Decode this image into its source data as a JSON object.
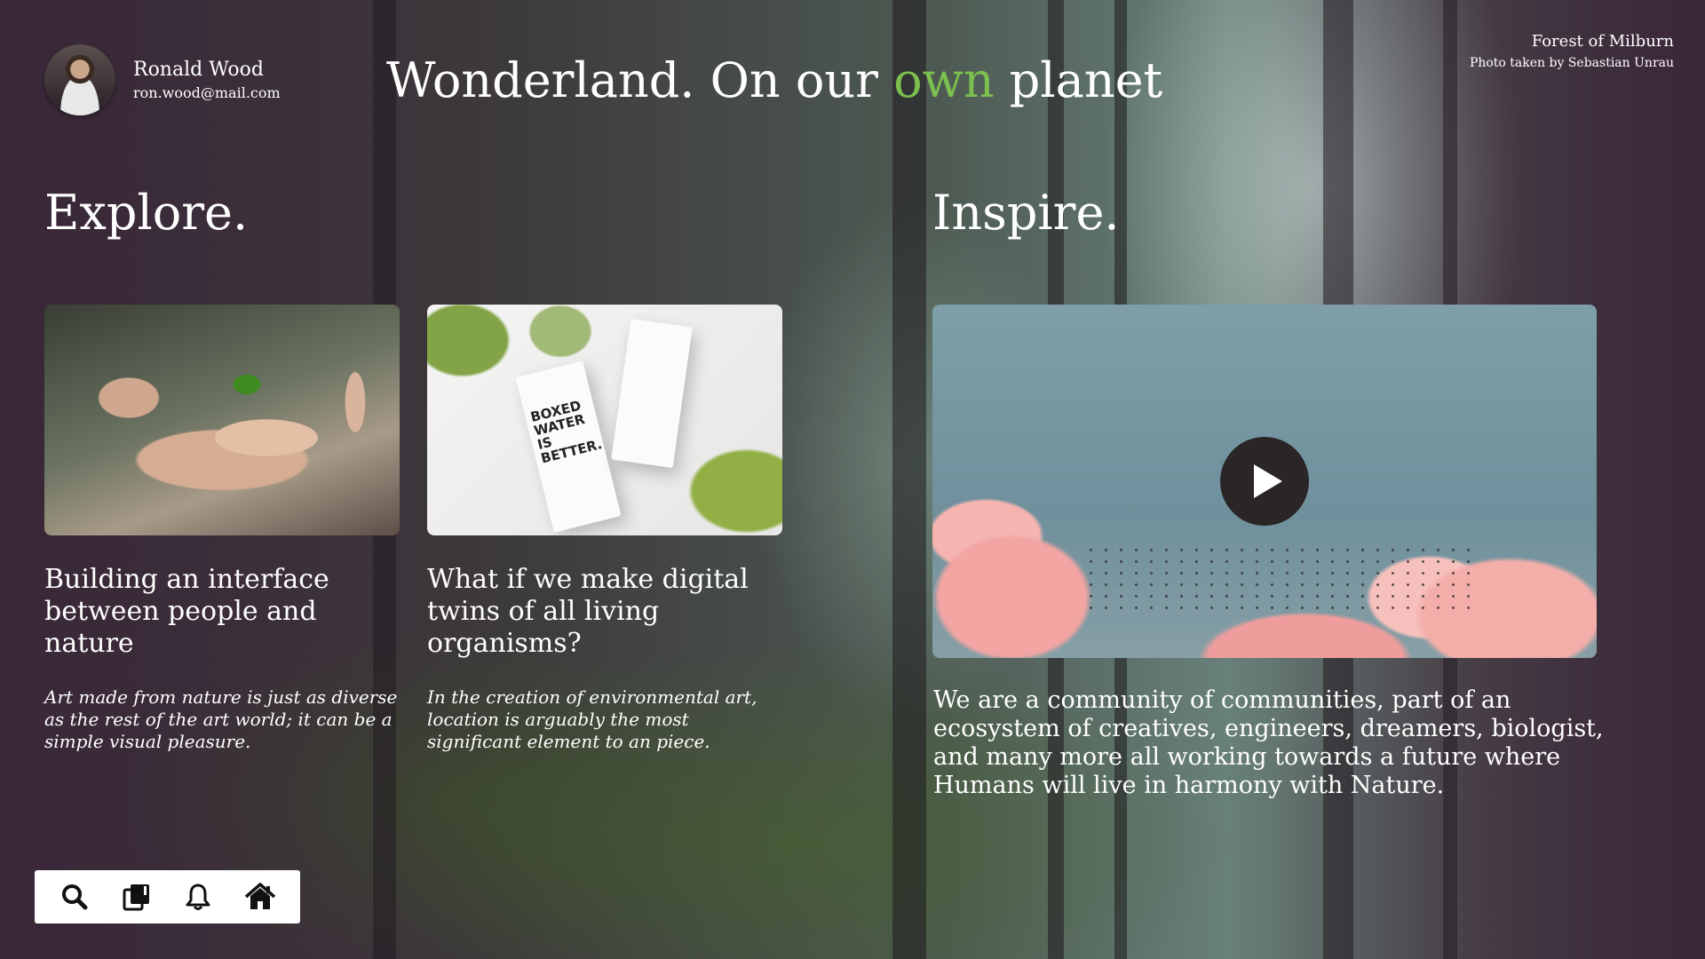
{
  "user": {
    "name": "Ronald Wood",
    "email": "ron.wood@mail.com"
  },
  "headline": {
    "before": "Wonderland. On our ",
    "accent": "own",
    "after": " planet",
    "accent_color": "#7bbf4f"
  },
  "photo_credit": {
    "title": "Forest of Milburn",
    "subtitle": "Photo taken by Sebastian Unrau"
  },
  "explore": {
    "heading": "Explore.",
    "cards": [
      {
        "title": "Building an interface between people and nature",
        "text": "Art made from nature is just as diverse as the rest of the art world; it can be a simple visual pleasure."
      },
      {
        "title": "What if we make digital twins of all living organisms?",
        "text": "In the creation of environmental art, location is arguably the most significant element to an piece.",
        "carton_label": "BOXED WATER IS BETTER."
      }
    ]
  },
  "inspire": {
    "heading": "Inspire.",
    "text": "We are a community of communities, part of an ecosystem of creatives, engineers, dreamers, biologist, and many more all working towards a future where Humans will live in harmony with Nature."
  },
  "toolbar": {
    "icons": [
      "search-icon",
      "library-icon",
      "bell-icon",
      "home-icon"
    ]
  }
}
